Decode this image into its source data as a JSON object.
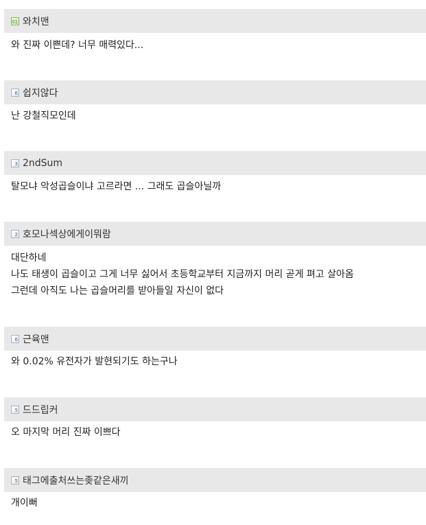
{
  "comments": [
    {
      "username": "와치맨",
      "icon": "level-icon",
      "icon_level": "01",
      "lines": [
        "와 진짜 이쁜데? 너무 매력있다..."
      ]
    },
    {
      "username": "쉽지않다",
      "icon": "level-icon",
      "icon_level": "6",
      "lines": [
        "난 강철직모인데"
      ]
    },
    {
      "username": "2ndSum",
      "icon": "level-icon",
      "icon_level": "3",
      "lines": [
        "탈모냐 악성곱슬이냐 고르라면 ... 그래도 곱슬아닐까"
      ]
    },
    {
      "username": "호모나섹상에게이뭐람",
      "icon": "level-icon",
      "icon_level": "2",
      "lines": [
        "대단하네",
        "나도 태생이 곱슬이고 그게 너무 싫어서 초등학교부터 지금까지 머리 곧게 펴고 살아옴",
        "그런데 아직도 나는 곱슬머리를 받아들일 자신이 없다"
      ]
    },
    {
      "username": "근육맨",
      "icon": "level-icon",
      "icon_level": "6",
      "lines": [
        "와 0.02% 유전자가 발현되기도 하는구나"
      ]
    },
    {
      "username": "드드립커",
      "icon": "level-icon",
      "icon_level": "5",
      "lines": [
        "오 마지막 머리 진짜 이쁘다"
      ]
    },
    {
      "username": "태그에출처쓰는좆같은새끼",
      "icon": "level-icon",
      "icon_level": "5",
      "lines": [
        "개이뻐"
      ]
    }
  ],
  "colors": {
    "header_bg": "#e8e8e8",
    "text": "#222222"
  }
}
